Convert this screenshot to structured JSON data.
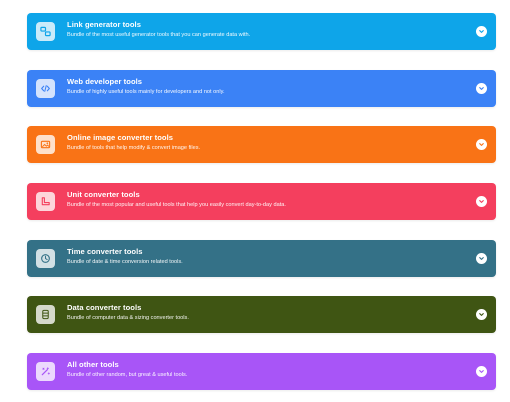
{
  "categories": [
    {
      "title": "Link generator tools",
      "description": "Bundle of the most useful generator tools that you can generate data with.",
      "color": "#0ea5e9",
      "icon": "link-generator-icon"
    },
    {
      "title": "Web developer tools",
      "description": "Bundle of highly useful tools mainly for developers and not only.",
      "color": "#3b82f6",
      "icon": "code-icon"
    },
    {
      "title": "Online image converter tools",
      "description": "Bundle of tools that help modify & convert image files.",
      "color": "#f97316",
      "icon": "image-icon"
    },
    {
      "title": "Unit converter tools",
      "description": "Bundle of the most popular and useful tools that help you easily convert day-to-day data.",
      "color": "#f43f5e",
      "icon": "ruler-icon"
    },
    {
      "title": "Time converter tools",
      "description": "Bundle of date & time conversion related tools.",
      "color": "#347187",
      "icon": "clock-icon"
    },
    {
      "title": "Data converter tools",
      "description": "Bundle of computer data & sizing converter tools.",
      "color": "#3f5513",
      "icon": "database-icon"
    },
    {
      "title": "All other tools",
      "description": "Bundle of other random, but great & useful tools.",
      "color": "#a855f7",
      "icon": "magic-wand-icon"
    }
  ]
}
